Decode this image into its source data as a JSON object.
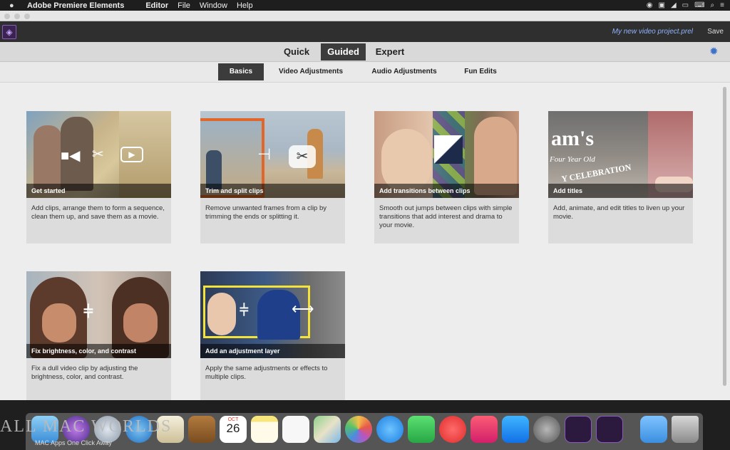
{
  "menubar": {
    "app": "Adobe Premiere Elements",
    "items": [
      "Editor",
      "File",
      "Window",
      "Help"
    ]
  },
  "header": {
    "project_name": "My new video project.prel",
    "save_label": "Save"
  },
  "modes": {
    "tabs": [
      "Quick",
      "Guided",
      "Expert"
    ],
    "active": "Guided"
  },
  "guided_tabs": {
    "tabs": [
      "Basics",
      "Video Adjustments",
      "Audio Adjustments",
      "Fun Edits"
    ],
    "active": "Basics"
  },
  "cards": [
    {
      "title": "Get started",
      "description": "Add clips, arrange them to form a sequence, clean them up, and save them as a movie."
    },
    {
      "title": "Trim and split clips",
      "description": "Remove unwanted frames from a clip by trimming the ends or splitting it."
    },
    {
      "title": "Add transitions between clips",
      "description": "Smooth out jumps between clips with simple transitions that add interest and drama to your movie."
    },
    {
      "title": "Add titles",
      "description": "Add, animate, and edit titles to liven up your movie."
    },
    {
      "title": "Fix brightness, color, and contrast",
      "description": "Fix a dull video clip by adjusting the brightness, color, and contrast."
    },
    {
      "title": "Add an adjustment layer",
      "description": "Apply the same adjustments or effects to multiple clips."
    }
  ],
  "thumb_text": {
    "title_card_words": "am's",
    "title_card_line2": "Four Year Old",
    "title_card_line3": "Y CELEBRATION"
  },
  "dock": {
    "calendar_month": "OCT",
    "calendar_day": "26"
  },
  "watermark": {
    "main": "ALL MAC WORLDS",
    "sub": "MAC Apps One Click Away"
  },
  "colors": {
    "accent": "#3d72c9",
    "active_tab": "#3c3c3c",
    "project_name": "#8fb4ff"
  }
}
